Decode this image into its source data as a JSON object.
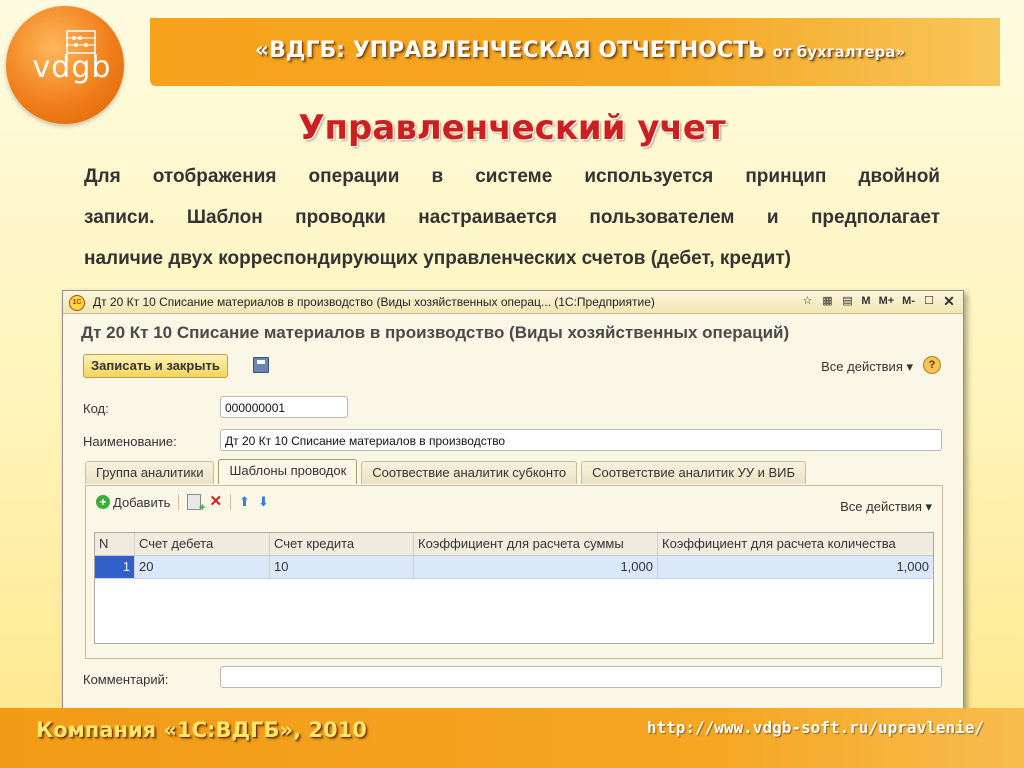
{
  "slide": {
    "logo_text": "vdgb",
    "header_main": "«ВДГБ: УПРАВЛЕНЧЕСКАЯ ОТЧЕТНОСТЬ",
    "header_small": "от бухгалтера»",
    "title": "Управленческий учет",
    "paragraph_lines": [
      "Для отображения операции в системе используется принцип двойной",
      "записи. Шаблон проводки настраивается пользователем и предполагает",
      "наличие двух корреспондирующих управленческих счетов (дебет, кредит)"
    ],
    "footer_company": "Компания «1С:ВДГБ», 2010",
    "footer_url": "http://www.vdgb-soft.ru/upravlenie/"
  },
  "window": {
    "app_icon_text": "1С",
    "title": "Дт 20 Кт 10 Списание материалов в производство (Виды хозяйственных операц... (1С:Предприятие)",
    "titlebar_buttons": {
      "m": "M",
      "m_plus": "M+",
      "m_minus": "M-"
    },
    "form_title": "Дт 20 Кт 10 Списание материалов в производство (Виды хозяйственных операций)",
    "save_close_label": "Записать и закрыть",
    "all_actions_label": "Все действия ▾",
    "help_label": "?",
    "code_label": "Код:",
    "code_value": "000000001",
    "name_label": "Наименование:",
    "name_value": "Дт 20 Кт 10 Списание материалов в производство",
    "tabs": [
      {
        "label": "Группа аналитики"
      },
      {
        "label": "Шаблоны проводок"
      },
      {
        "label": "Соотвествие аналитик субконто"
      },
      {
        "label": "Соответствие аналитик УУ и ВИБ"
      }
    ],
    "panel": {
      "add_label": "Добавить",
      "all_actions_label": "Все действия ▾",
      "columns": [
        "N",
        "Счет дебета",
        "Счет кредита",
        "Коэффициент для расчета суммы",
        "Коэффициент для расчета количества"
      ],
      "rows": [
        {
          "n": "1",
          "debit": "20",
          "credit": "10",
          "sum_coef": "1,000",
          "qty_coef": "1,000"
        }
      ]
    },
    "comment_label": "Комментарий:",
    "comment_value": ""
  }
}
